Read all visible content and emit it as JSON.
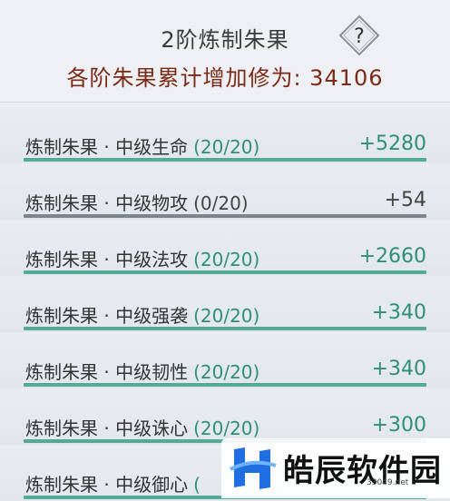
{
  "header": {
    "title": "2阶炼制朱果",
    "help_icon": "question-mark-diamond-icon",
    "summary": "各阶朱果累计增加修为: 34106"
  },
  "items": [
    {
      "name": "炼制朱果 · 中级生命",
      "progress": "(20/20)",
      "bonus": "+5280",
      "complete": true
    },
    {
      "name": "炼制朱果 · 中级物攻",
      "progress": "(0/20)",
      "bonus": "+54",
      "complete": false
    },
    {
      "name": "炼制朱果 · 中级法攻",
      "progress": "(20/20)",
      "bonus": "+2660",
      "complete": true
    },
    {
      "name": "炼制朱果 · 中级强袭",
      "progress": "(20/20)",
      "bonus": "+340",
      "complete": true
    },
    {
      "name": "炼制朱果 · 中级韧性",
      "progress": "(20/20)",
      "bonus": "+340",
      "complete": true
    },
    {
      "name": "炼制朱果 · 中级诛心",
      "progress": "(20/20)",
      "bonus": "+300",
      "complete": true
    },
    {
      "name": "炼制朱果 · 中级御心",
      "progress": "(",
      "bonus": "",
      "complete": true
    }
  ],
  "colors": {
    "complete": "#2f8f77",
    "incomplete": "#444444",
    "summary": "#7a2a16"
  },
  "watermark": {
    "text": "皓辰软件园",
    "url": "33049.net",
    "logo_icon": "h-logo-icon"
  }
}
